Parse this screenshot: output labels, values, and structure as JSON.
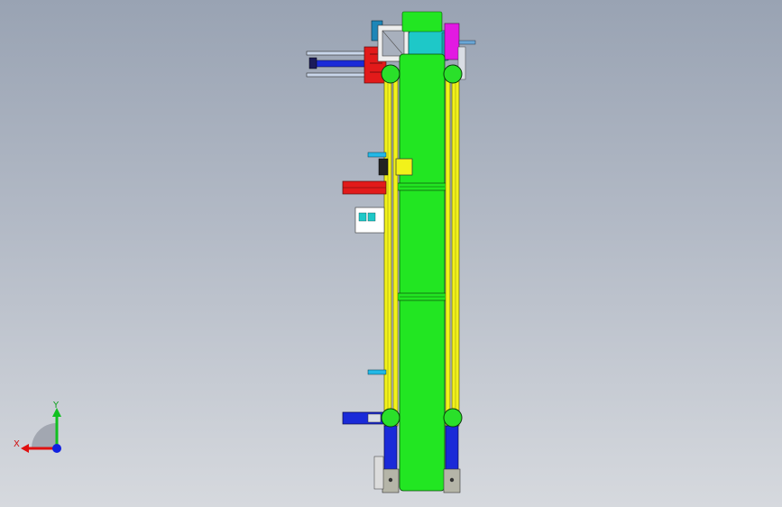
{
  "viewport": {
    "background_top": "#99a3b3",
    "background_bottom": "#d6d9de"
  },
  "triad": {
    "x_label": "X",
    "y_label": "Y",
    "x_color": "#e01010",
    "y_color": "#10c020",
    "z_color": "#1020e0"
  },
  "model": {
    "belt_color": "#22e622",
    "rail_color": "#f2f21a",
    "pulley_color": "#2ae02a",
    "motor_color": "#1ec8c8",
    "accent_red": "#e21a1a",
    "accent_blue": "#1a2ad8",
    "accent_magenta": "#e21ae2"
  }
}
